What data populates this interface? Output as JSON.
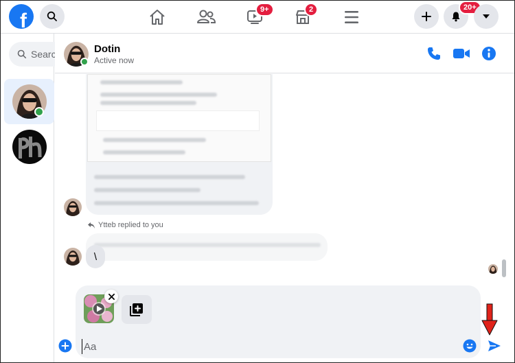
{
  "topnav": {
    "logo_letter": "f",
    "video_badge": "9+",
    "marketplace_badge": "2",
    "notifications_badge": "20+"
  },
  "sidebar": {
    "search_placeholder": "Search"
  },
  "chat": {
    "contact_name": "Dotin",
    "contact_status": "Active now",
    "reply_note": "Ytteb replied to you",
    "last_message": "\\",
    "composer_placeholder": "Aa"
  },
  "colors": {
    "brand": "#1877f2",
    "badge": "#e41e3f",
    "online": "#31a24c",
    "annotation_arrow": "#e0231a"
  }
}
